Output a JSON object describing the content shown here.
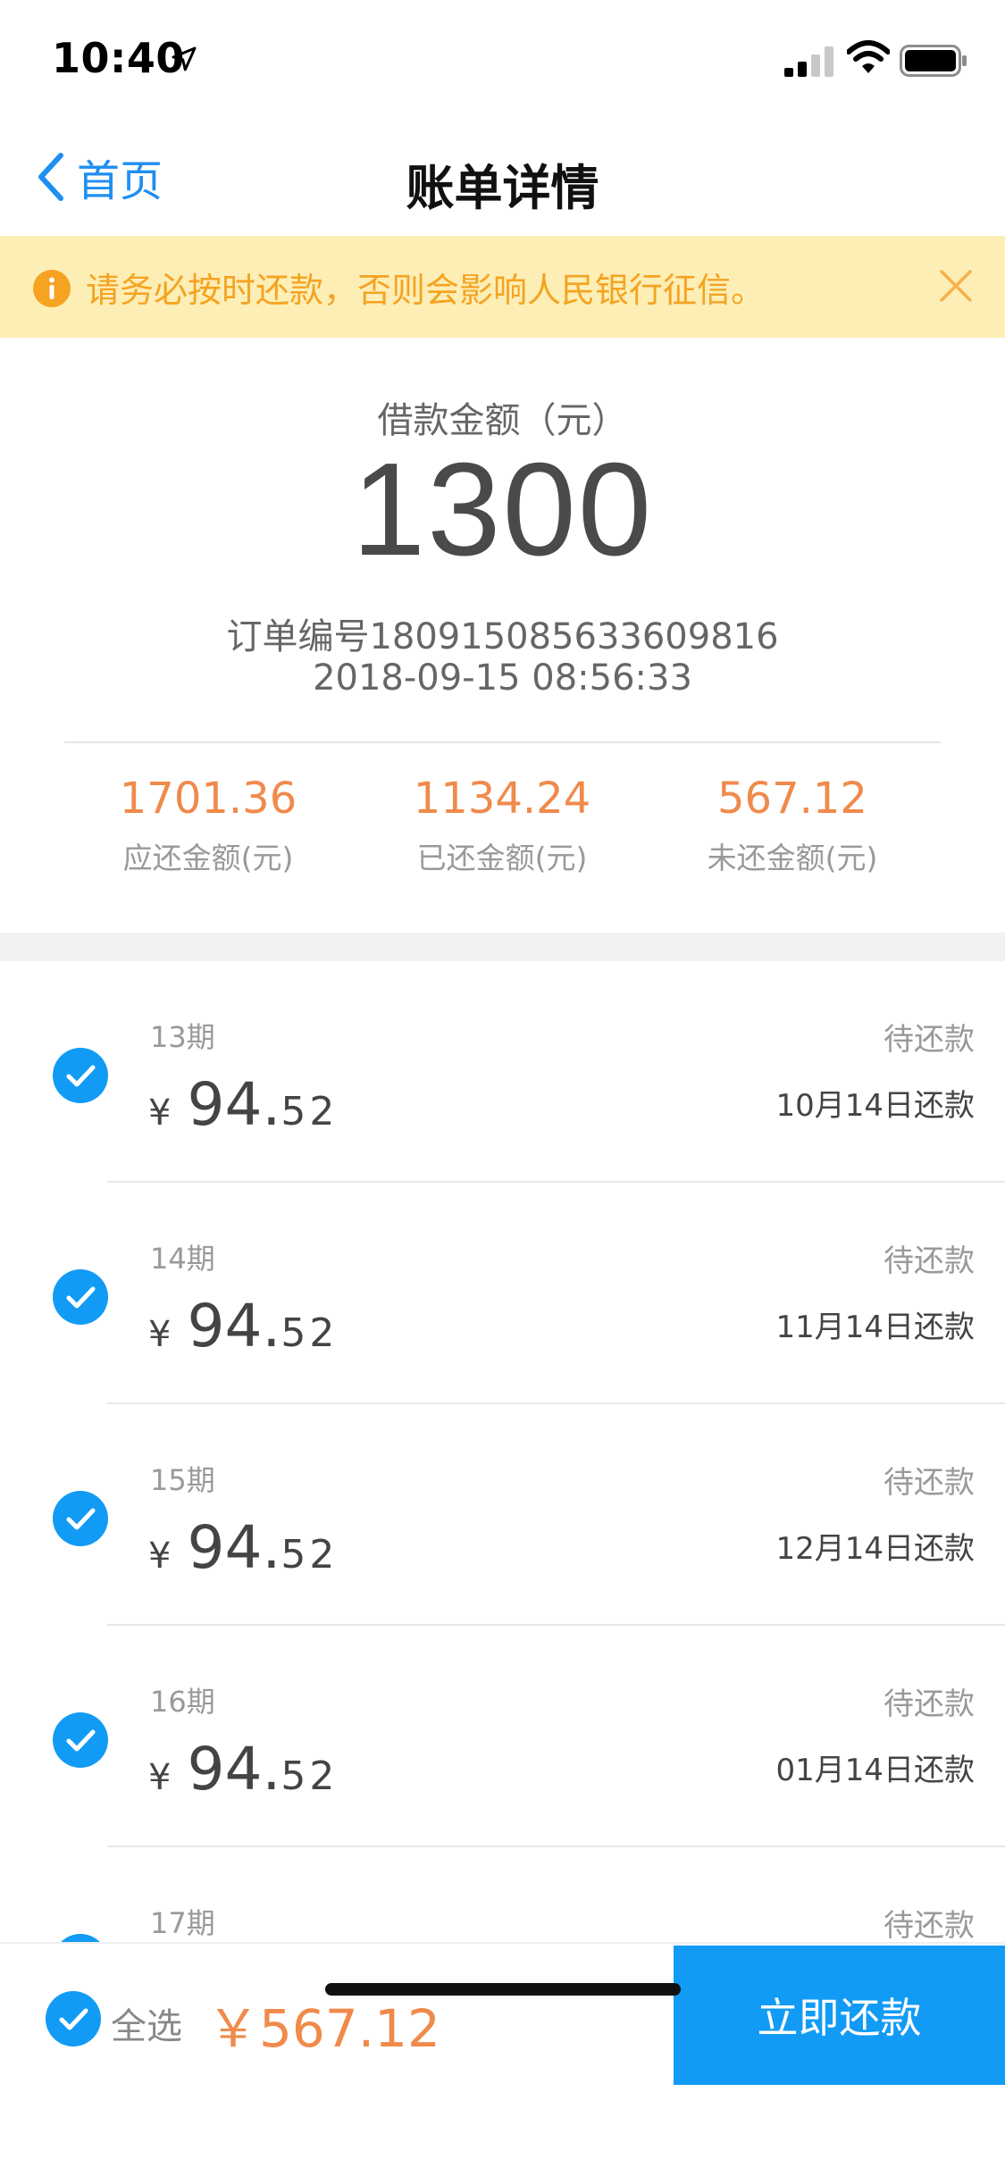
{
  "status_bar": {
    "time": "10:40"
  },
  "nav": {
    "back_label": "首页",
    "title": "账单详情"
  },
  "notice": {
    "text": "请务必按时还款，否则会影响人民银行征信。"
  },
  "summary": {
    "loan_label": "借款金额（元）",
    "loan_amount": "1300",
    "order_number": "订单编号180915085633609816",
    "order_time": "2018-09-15 08:56:33",
    "stats": [
      {
        "value": "1701.36",
        "label": "应还金额(元)"
      },
      {
        "value": "1134.24",
        "label": "已还金额(元)"
      },
      {
        "value": "567.12",
        "label": "未还金额(元)"
      }
    ]
  },
  "installments": [
    {
      "period": "13期",
      "status": "待还款",
      "currency": "¥",
      "amount_int": "94.",
      "amount_dec": "52",
      "due": "10月14日还款",
      "checked": true
    },
    {
      "period": "14期",
      "status": "待还款",
      "currency": "¥",
      "amount_int": "94.",
      "amount_dec": "52",
      "due": "11月14日还款",
      "checked": true
    },
    {
      "period": "15期",
      "status": "待还款",
      "currency": "¥",
      "amount_int": "94.",
      "amount_dec": "52",
      "due": "12月14日还款",
      "checked": true
    },
    {
      "period": "16期",
      "status": "待还款",
      "currency": "¥",
      "amount_int": "94.",
      "amount_dec": "52",
      "due": "01月14日还款",
      "checked": true
    },
    {
      "period": "17期",
      "status": "待还款",
      "currency": "",
      "amount_int": "",
      "amount_dec": "",
      "due": "",
      "checked": true
    }
  ],
  "bottom": {
    "select_all_label": "全选",
    "total": "￥567.12",
    "pay_button": "立即还款"
  },
  "colors": {
    "accent_blue": "#129bf5",
    "nav_blue": "#1f8ef1",
    "amount_orange": "#f08a4b",
    "notice_bg": "#fdeeb6",
    "notice_text": "#f5a321"
  }
}
